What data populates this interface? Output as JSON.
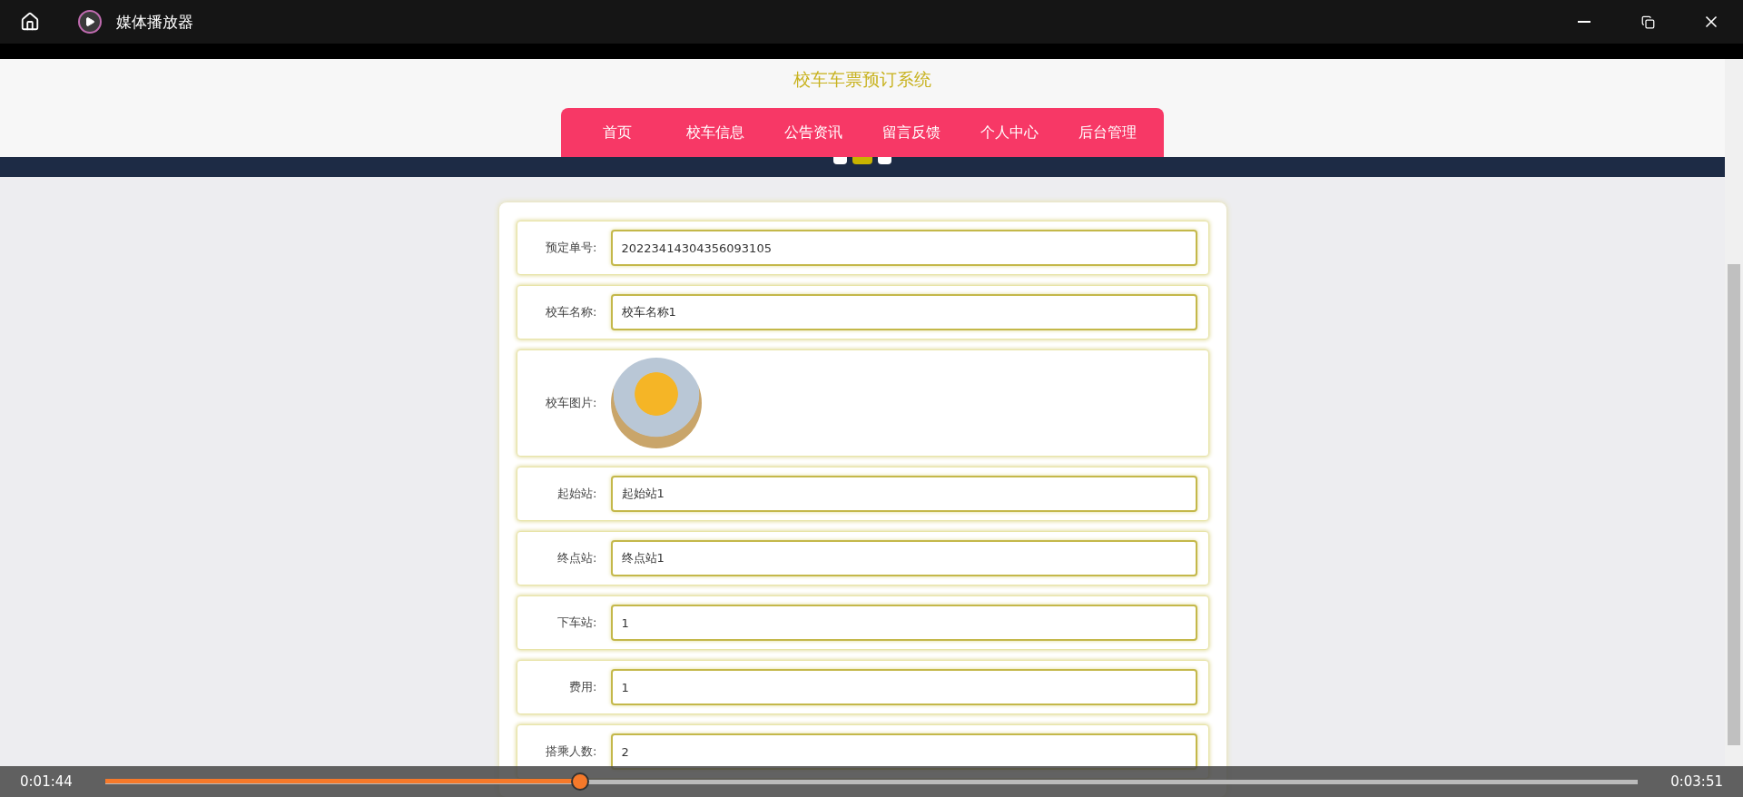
{
  "window": {
    "title": "媒体播放器"
  },
  "page": {
    "site_title": "校车车票预订系统",
    "nav": [
      "首页",
      "校车信息",
      "公告资讯",
      "留言反馈",
      "个人中心",
      "后台管理"
    ],
    "carousel_dots": [
      {
        "selected": false
      },
      {
        "selected": true
      },
      {
        "selected": false
      }
    ],
    "form": [
      {
        "kind": "text",
        "label": "预定单号:",
        "value": "20223414304356093105"
      },
      {
        "kind": "text",
        "label": "校车名称:",
        "value": "校车名称1"
      },
      {
        "kind": "image",
        "label": "校车图片:"
      },
      {
        "kind": "text",
        "label": "起始站:",
        "value": "起始站1"
      },
      {
        "kind": "text",
        "label": "终点站:",
        "value": "终点站1"
      },
      {
        "kind": "text",
        "label": "下车站:",
        "value": "1"
      },
      {
        "kind": "text",
        "label": "费用:",
        "value": "1"
      },
      {
        "kind": "text",
        "label": "搭乘人数:",
        "value": "2"
      }
    ]
  },
  "player": {
    "elapsed": "0:01:44",
    "total": "0:03:51",
    "level": 0.31
  }
}
